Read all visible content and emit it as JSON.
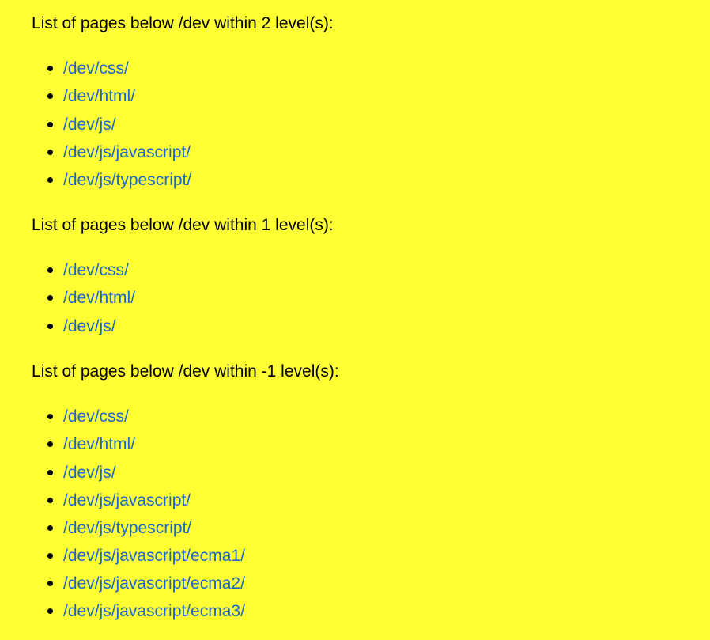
{
  "colors": {
    "background": "#FFFF33",
    "link": "#1A66CC",
    "text": "#000000"
  },
  "sections": [
    {
      "heading": "List of pages below /dev within 2 level(s):",
      "links": [
        "/dev/css/",
        "/dev/html/",
        "/dev/js/",
        "/dev/js/javascript/",
        "/dev/js/typescript/"
      ]
    },
    {
      "heading": "List of pages below /dev within 1 level(s):",
      "links": [
        "/dev/css/",
        "/dev/html/",
        "/dev/js/"
      ]
    },
    {
      "heading": "List of pages below /dev within -1 level(s):",
      "links": [
        "/dev/css/",
        "/dev/html/",
        "/dev/js/",
        "/dev/js/javascript/",
        "/dev/js/typescript/",
        "/dev/js/javascript/ecma1/",
        "/dev/js/javascript/ecma2/",
        "/dev/js/javascript/ecma3/"
      ]
    }
  ]
}
